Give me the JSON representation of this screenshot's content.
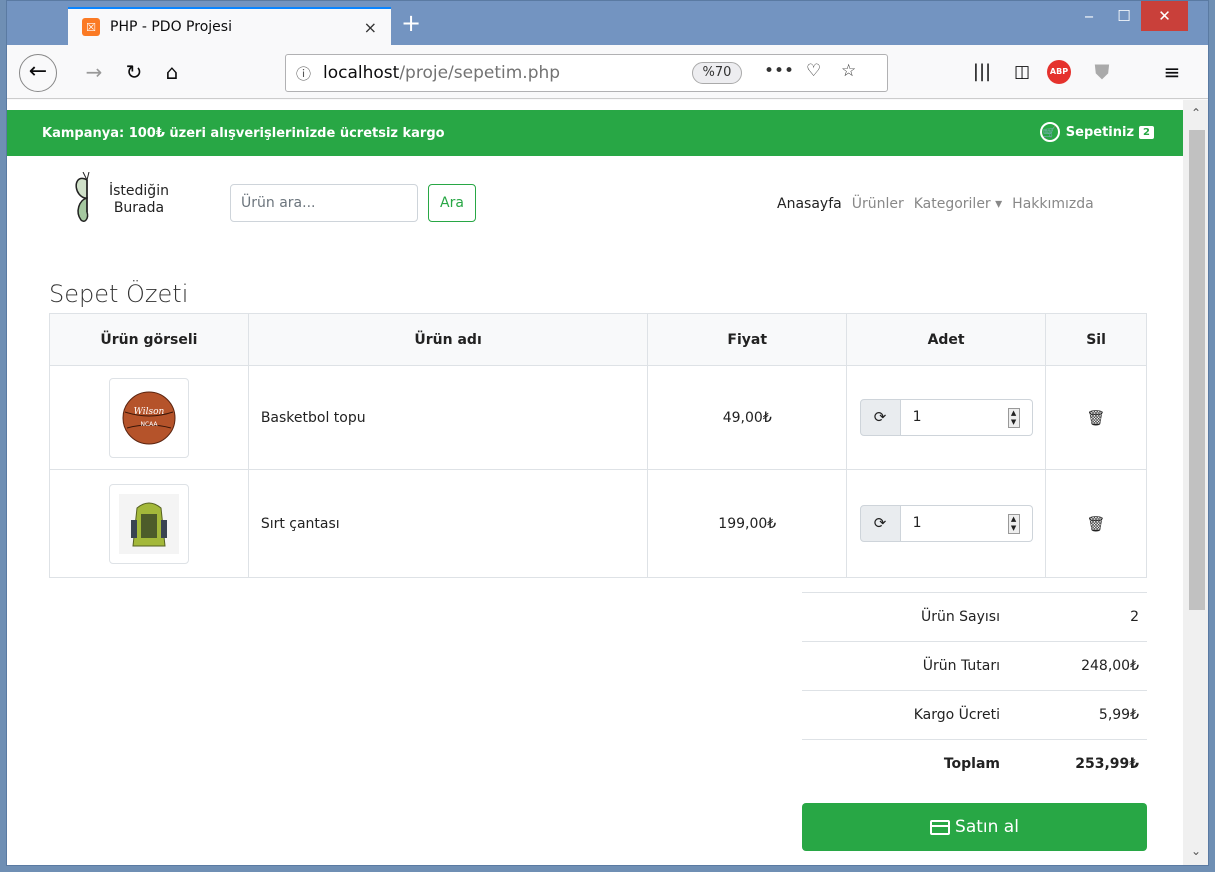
{
  "browser": {
    "tab_title": "PHP - PDO Projesi",
    "tab_close": "×",
    "new_tab": "+",
    "window_controls": {
      "minimize": "‒",
      "maximize": "☐",
      "close": "✕"
    },
    "url_host": "localhost",
    "url_path": "/proje/sepetim.php",
    "zoom": "%70",
    "icons": [
      "back-icon",
      "forward-icon",
      "reload-icon",
      "home-icon",
      "info-icon",
      "more-icon",
      "pocket-icon",
      "bookmark-star-icon",
      "library-icon",
      "sidebar-icon",
      "adblock-icon",
      "shield-icon",
      "menu-icon"
    ]
  },
  "site": {
    "campaign": "Kampanya: 100₺ üzeri alışverişlerinizde ücretsiz kargo",
    "cart_link": "Sepetiniz",
    "cart_count": "2",
    "logo_line1": "İstediğin",
    "logo_line2": "Burada",
    "search_placeholder": "Ürün ara...",
    "search_button": "Ara",
    "menu": {
      "home": "Anasayfa",
      "products": "Ürünler",
      "categories": "Kategoriler ▾",
      "about": "Hakkımızda"
    }
  },
  "cart": {
    "title": "Sepet Özeti",
    "headers": {
      "image": "Ürün görseli",
      "name": "Ürün adı",
      "price": "Fiyat",
      "qty": "Adet",
      "delete": "Sil"
    },
    "rows": [
      {
        "name": "Basketbol topu",
        "price": "49,00₺",
        "qty": "1",
        "image_icon": "basketball-icon"
      },
      {
        "name": "Sırt çantası",
        "price": "199,00₺",
        "qty": "1",
        "image_icon": "backpack-icon"
      }
    ]
  },
  "totals": {
    "count_label": "Ürün Sayısı",
    "count_value": "2",
    "subtotal_label": "Ürün Tutarı",
    "subtotal_value": "248,00₺",
    "shipping_label": "Kargo Ücreti",
    "shipping_value": "5,99₺",
    "total_label": "Toplam",
    "total_value": "253,99₺"
  },
  "buy_button": "Satın al",
  "colors": {
    "brand_green": "#28a745",
    "titlebar": "#7394c1",
    "close_red": "#c9403a"
  }
}
